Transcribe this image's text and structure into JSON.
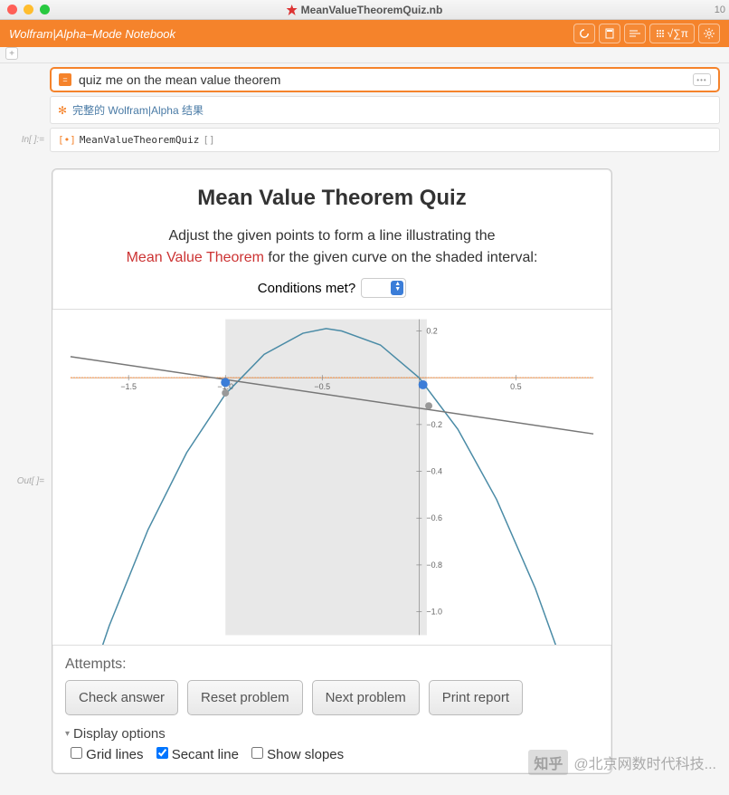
{
  "titlebar": {
    "filename": "MeanValueTheoremQuiz.nb",
    "zoom": "10"
  },
  "orange": {
    "title": "Wolfram|Alpha–Mode Notebook",
    "symbols": "√∑π"
  },
  "input": {
    "text": "quiz me on the mean value theorem"
  },
  "walpha": {
    "text": "完整的 Wolfram|Alpha 结果"
  },
  "labels": {
    "in": "In[ ]:=",
    "out": "Out[ ]="
  },
  "code": {
    "fn": "MeanValueTheoremQuiz",
    "args": "[]"
  },
  "quiz": {
    "title": "Mean Value Theorem Quiz",
    "desc1": "Adjust the given points to form a line illustrating the",
    "mvt": "Mean Value Theorem",
    "desc2": " for the given curve on the shaded interval:",
    "conditions": "Conditions met?",
    "attempts": "Attempts:",
    "buttons": {
      "check": "Check answer",
      "reset": "Reset problem",
      "next": "Next problem",
      "print": "Print report"
    },
    "display": "Display options",
    "checks": {
      "grid": "Grid lines",
      "secant": "Secant line",
      "slopes": "Show slopes"
    }
  },
  "watermark": {
    "logo": "知乎",
    "text": "@北京网数时代科技..."
  },
  "chart_data": {
    "type": "line",
    "xlim": [
      -1.8,
      0.9
    ],
    "ylim": [
      -1.1,
      0.25
    ],
    "xticks": [
      -1.5,
      -1.0,
      -0.5,
      0.5
    ],
    "yticks": [
      0.2,
      -0.2,
      -0.4,
      -0.6,
      -0.8,
      -1.0
    ],
    "shaded_interval": [
      -1.0,
      0.04
    ],
    "curve": {
      "name": "parabola",
      "x": [
        -1.8,
        -1.6,
        -1.4,
        -1.2,
        -1.0,
        -0.8,
        -0.6,
        -0.48,
        -0.4,
        -0.2,
        0.0,
        0.2,
        0.4,
        0.6,
        0.8,
        0.9
      ],
      "y": [
        -1.55,
        -1.06,
        -0.65,
        -0.32,
        -0.07,
        0.1,
        0.19,
        0.21,
        0.2,
        0.14,
        0.0,
        -0.22,
        -0.52,
        -0.9,
        -1.36,
        -1.62
      ]
    },
    "secant": {
      "p1": {
        "x": -1.8,
        "y": 0.09
      },
      "p2": {
        "x": 0.9,
        "y": -0.24
      }
    },
    "points": {
      "blue": [
        {
          "x": -1.0,
          "y": -0.02
        },
        {
          "x": 0.02,
          "y": -0.03
        }
      ],
      "gray": [
        {
          "x": -1.0,
          "y": -0.065
        },
        {
          "x": 0.05,
          "y": -0.12
        }
      ]
    }
  }
}
